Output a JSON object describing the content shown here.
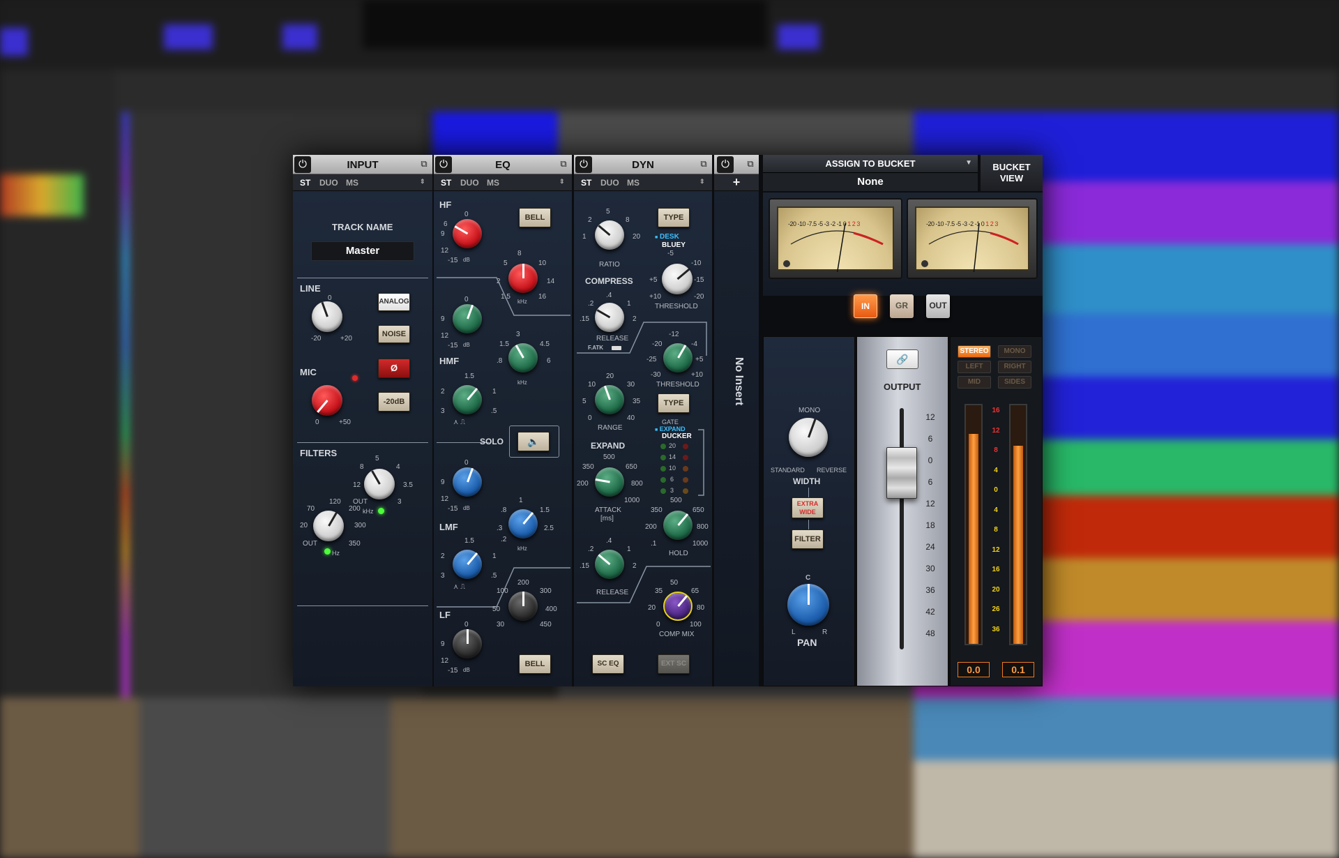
{
  "modules": {
    "input": {
      "title": "INPUT",
      "modes": [
        "ST",
        "DUO",
        "MS"
      ],
      "track_name_label": "TRACK NAME",
      "track_name_value": "Master",
      "line_label": "LINE",
      "line_min": "-20",
      "line_mid": "0",
      "line_max": "+20",
      "analog_label": "ANALOG",
      "noise_label": "NOISE",
      "phase_label": "Ø",
      "mic_label": "MIC",
      "mic_min": "0",
      "mic_max": "+50",
      "pad_label": "-20dB",
      "filters_label": "FILTERS",
      "lpf_unit": "kHz",
      "hpf_unit": "Hz",
      "hpf_ticks": [
        "70",
        "120",
        "200",
        "300",
        "350",
        "20",
        "OUT"
      ],
      "lpf_ticks": [
        "8",
        "5",
        "4",
        "3.5",
        "3",
        "OUT",
        "12"
      ]
    },
    "eq": {
      "title": "EQ",
      "modes": [
        "ST",
        "DUO",
        "MS"
      ],
      "hf_label": "HF",
      "hmf_label": "HMF",
      "lmf_label": "LMF",
      "lf_label": "LF",
      "bell_label": "BELL",
      "solo_label": "SOLO",
      "khz_unit": "kHz",
      "db_unit": "dB",
      "hf_freq_ticks": [
        "5",
        "8",
        "10",
        "14",
        "16",
        "2",
        "1.5"
      ],
      "hmf_freq_ticks": [
        "3",
        "4.5",
        "6",
        ".8",
        "1.5"
      ],
      "lmf_freq_ticks": [
        "1",
        "1.5",
        "2.5",
        ".2",
        ".3",
        ".8"
      ],
      "lf_freq_ticks": [
        "200",
        "300",
        "400",
        "450",
        "100",
        "50",
        "30"
      ],
      "gain_ticks": [
        "0",
        "3",
        "6",
        "9",
        "12",
        "15",
        "-15"
      ]
    },
    "dyn": {
      "title": "DYN",
      "modes": [
        "ST",
        "DUO",
        "MS"
      ],
      "type_label": "TYPE",
      "desk_label": "DESK",
      "bluey_label": "BLUEY",
      "ratio_label": "RATIO",
      "compress_label": "COMPRESS",
      "threshold_label": "THRESHOLD",
      "release_label": "RELEASE",
      "fatk_label": "F.ATK",
      "range_label": "RANGE",
      "gate_label": "GATE",
      "expand_small_label": "EXPAND",
      "ducker_label": "DUCKER",
      "expand_label": "EXPAND",
      "attack_label": "ATTACK",
      "ms_label": "[ms]",
      "hold_label": "HOLD",
      "comp_mix_label": "COMP MIX",
      "sc_eq_label": "SC EQ",
      "ext_sc_label": "EXT SC",
      "gr_leds": [
        "20",
        "14",
        "10",
        "6",
        "3"
      ],
      "ratio_ticks": [
        "5",
        "8",
        "20",
        "2",
        "1"
      ],
      "threshold_ticks": [
        "-5",
        "-10",
        "-15",
        "-20",
        "+10",
        "+5"
      ],
      "range_ticks": [
        "20",
        "30",
        "35",
        "40",
        "10",
        "5",
        "0"
      ],
      "attack_ticks": [
        "500",
        "650",
        "800",
        "1000",
        "350",
        "200"
      ],
      "hold_ticks": [
        "500",
        "650",
        "800",
        "1000",
        "350",
        "200",
        ".1"
      ],
      "mix_ticks": [
        "50",
        "65",
        "80",
        "100",
        "35",
        "20",
        "0"
      ]
    },
    "insert": {
      "label": "No Insert",
      "add_label": "+"
    }
  },
  "bucket": {
    "assign_label": "ASSIGN TO BUCKET",
    "value": "None",
    "view_label_1": "BUCKET",
    "view_label_2": "VIEW"
  },
  "meter": {
    "vu_ticks": [
      "-20",
      "-10",
      "-7.5",
      "-5",
      "-3",
      "-2",
      "-1",
      "0",
      "1",
      "2",
      "3"
    ],
    "in_label": "IN",
    "gr_label": "GR",
    "out_label": "OUT",
    "active_mode": "IN"
  },
  "width_section": {
    "mono_label": "MONO",
    "standard_label": "STANDARD",
    "reverse_label": "REVERSE",
    "width_label": "WIDTH",
    "extra_wide_label_1": "EXTRA",
    "extra_wide_label_2": "WIDE",
    "filter_label": "FILTER",
    "pan_c_label": "C",
    "pan_l_label": "L",
    "pan_r_label": "R",
    "pan_label": "PAN"
  },
  "output": {
    "label": "OUTPUT",
    "fader_scale": [
      "12",
      "6",
      "0",
      "6",
      "12",
      "18",
      "24",
      "30",
      "36",
      "42",
      "48"
    ],
    "fader_value": 0
  },
  "routing": {
    "stereo_label": "STEREO",
    "mono_label": "MONO",
    "left_label": "LEFT",
    "right_label": "RIGHT",
    "mid_label": "MID",
    "sides_label": "SIDES",
    "active": "STEREO"
  },
  "level_meter": {
    "scale": [
      "16",
      "12",
      "8",
      "4",
      "0",
      "4",
      "8",
      "12",
      "16",
      "20",
      "26",
      "36"
    ],
    "left_value": "0.0",
    "right_value": "0.1",
    "left_level": 0.88,
    "right_level": 0.83
  },
  "colors": {
    "accent_orange": "#ff7a1e",
    "led_green": "#4dff3a",
    "meter_bar": "#ff8c1a"
  }
}
